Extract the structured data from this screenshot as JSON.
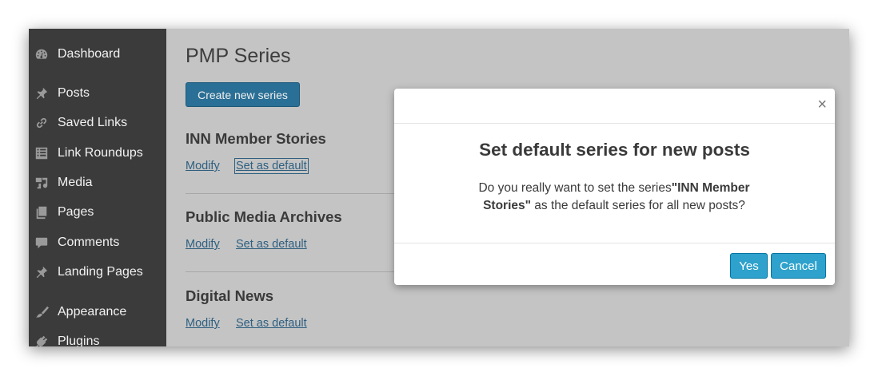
{
  "sidebar": {
    "items": [
      {
        "label": "Dashboard",
        "icon": "dashboard-icon"
      },
      {
        "label": "Posts",
        "icon": "pin-icon"
      },
      {
        "label": "Saved Links",
        "icon": "link-icon"
      },
      {
        "label": "Link Roundups",
        "icon": "list-icon"
      },
      {
        "label": "Media",
        "icon": "media-icon"
      },
      {
        "label": "Pages",
        "icon": "pages-icon"
      },
      {
        "label": "Comments",
        "icon": "comment-icon"
      },
      {
        "label": "Landing Pages",
        "icon": "pin-icon"
      },
      {
        "label": "Appearance",
        "icon": "brush-icon"
      },
      {
        "label": "Plugins",
        "icon": "plug-icon"
      }
    ]
  },
  "page": {
    "title": "PMP Series",
    "create_button": "Create new series"
  },
  "series": [
    {
      "name": "INN Member Stories",
      "modify": "Modify",
      "set_default": "Set as default"
    },
    {
      "name": "Public Media Archives",
      "modify": "Modify",
      "set_default": "Set as default"
    },
    {
      "name": "Digital News",
      "modify": "Modify",
      "set_default": "Set as default"
    }
  ],
  "modal": {
    "close": "×",
    "title": "Set default series for new posts",
    "body_before": "Do you really want to set the series",
    "body_bold": "\"INN Member Stories\"",
    "body_after": " as the default series for all new posts?",
    "yes": "Yes",
    "cancel": "Cancel"
  },
  "colors": {
    "sidebar_bg": "#3b3b3b",
    "primary_button": "#2a6f95",
    "modal_button": "#2ea2cc",
    "link": "#2e5f80"
  }
}
